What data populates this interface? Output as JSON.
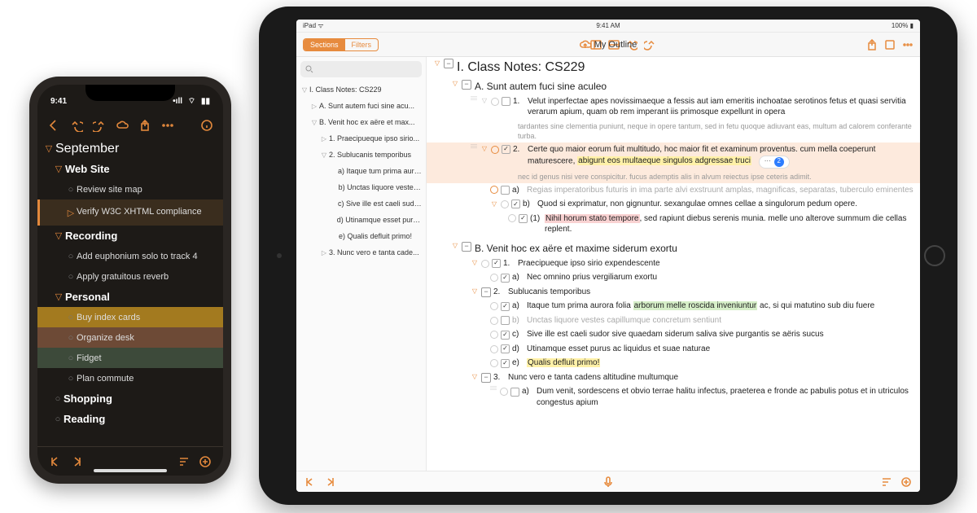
{
  "phone": {
    "status": {
      "time": "9:41",
      "signal": "•ıll",
      "wifi": "⌔",
      "battery": "▮▮"
    },
    "outline_title": "September",
    "sections": [
      {
        "label": "Web Site",
        "items": [
          {
            "label": "Review site map"
          },
          {
            "label": "Verify W3C XHTML compliance",
            "selected": true,
            "play": true
          }
        ]
      },
      {
        "label": "Recording",
        "items": [
          {
            "label": "Add euphonium solo to track 4"
          },
          {
            "label": "Apply gratuitous reverb"
          }
        ]
      },
      {
        "label": "Personal",
        "items": [
          {
            "label": "Buy index cards",
            "hl": "yellow"
          },
          {
            "label": "Organize desk",
            "hl": "brown"
          },
          {
            "label": "Fidget",
            "hl": "green"
          },
          {
            "label": "Plan commute"
          }
        ]
      },
      {
        "label": "Shopping",
        "items": []
      },
      {
        "label": "Reading",
        "items": []
      }
    ]
  },
  "tablet": {
    "status": {
      "carrier": "iPad ᯤ",
      "time": "9:41 AM",
      "battery": "100% ▮"
    },
    "seg": {
      "a": "Sections",
      "b": "Filters"
    },
    "title": "My Outline",
    "badge_count": "2",
    "sidebar": [
      {
        "d": "▽",
        "pad": 0,
        "label": "I. Class Notes: CS229"
      },
      {
        "d": "▷",
        "pad": 12,
        "label": "A. Sunt autem fuci sine acu..."
      },
      {
        "d": "▽",
        "pad": 12,
        "label": "B. Venit hoc ex aëre et max..."
      },
      {
        "d": "▷",
        "pad": 24,
        "label": "1. Praecipueque ipso sirio..."
      },
      {
        "d": "▽",
        "pad": 24,
        "label": "2. Sublucanis temporibus"
      },
      {
        "d": "",
        "pad": 36,
        "label": "a) Itaque tum prima auro..."
      },
      {
        "d": "",
        "pad": 36,
        "label": "b) Unctas liquore vestes..."
      },
      {
        "d": "",
        "pad": 36,
        "label": "c) Sive ille est caeli sudo..."
      },
      {
        "d": "",
        "pad": 36,
        "label": "d) Utinamque esset purus..."
      },
      {
        "d": "",
        "pad": 36,
        "label": "e) Qualis defluit primo!"
      },
      {
        "d": "▷",
        "pad": 24,
        "label": "3. Nunc vero e tanta cade..."
      }
    ],
    "rows": {
      "r0": "I.  Class Notes: CS229",
      "rA": "A.  Sunt autem fuci sine aculeo",
      "rA1": "Velut inperfectae apes novissimaeque a fessis aut iam emeritis inchoatae serotinos fetus et quasi servitia verarum apium, quam ob rem imperant iis primosque expellunt in opera",
      "rA1n": "tardantes sine clementia puniunt, neque in opere tantum, sed in fetu quoque adiuvant eas, multum ad calorem conferante turba.",
      "rA2": "Certe quo maior eorum fuit multitudo, hoc maior fit et examinum proventus. cum mella coeperunt maturescere,",
      "rA2b": "abigunt eos multaeque singulos adgressae truci",
      "rA2n": "nec id genus nisi vere conspicitur. fucus ademptis alis in alvum reiectus ipse ceteris adimit.",
      "rA2a": "Regias imperatoribus futuris in ima parte alvi exstruunt amplas, magnificas, separatas, tuberculo eminentes",
      "rA2bq": "Quod si exprimatur, non gignuntur. sexangulae omnes cellae a singulorum pedum opere.",
      "rA2b1a": "Nihil horum stato tempore",
      "rA2b1b": ", sed rapiunt diebus serenis munia. melle uno alterove summum die cellas replent.",
      "rB": "B.  Venit hoc ex aëre et maxime siderum exortu",
      "rB1": "Praecipueque ipso sirio expendescente",
      "rB1a": "Nec omnino prius vergiliarum exortu",
      "rB2": "Sublucanis temporibus",
      "rB2a_pre": "Itaque tum prima aurora folia ",
      "rB2a_hl": "arborum melle roscida inveniuntur",
      "rB2a_post": " ac, si qui matutino sub diu fuere",
      "rB2b": "Unctas liquore vestes capillumque concretum sentiunt",
      "rB2c": "Sive ille est caeli sudor sive quaedam siderum saliva sive purgantis se aëris sucus",
      "rB2d": "Utinamque esset purus ac liquidus et suae naturae",
      "rB2e": "Qualis defluit primo!",
      "rB3": "Nunc vero e tanta cadens altitudine multumque",
      "rB3a": "Dum venit, sordescens et obvio terrae halitu infectus, praeterea e fronde ac pabulis potus et in utriculos congestus apium"
    }
  }
}
